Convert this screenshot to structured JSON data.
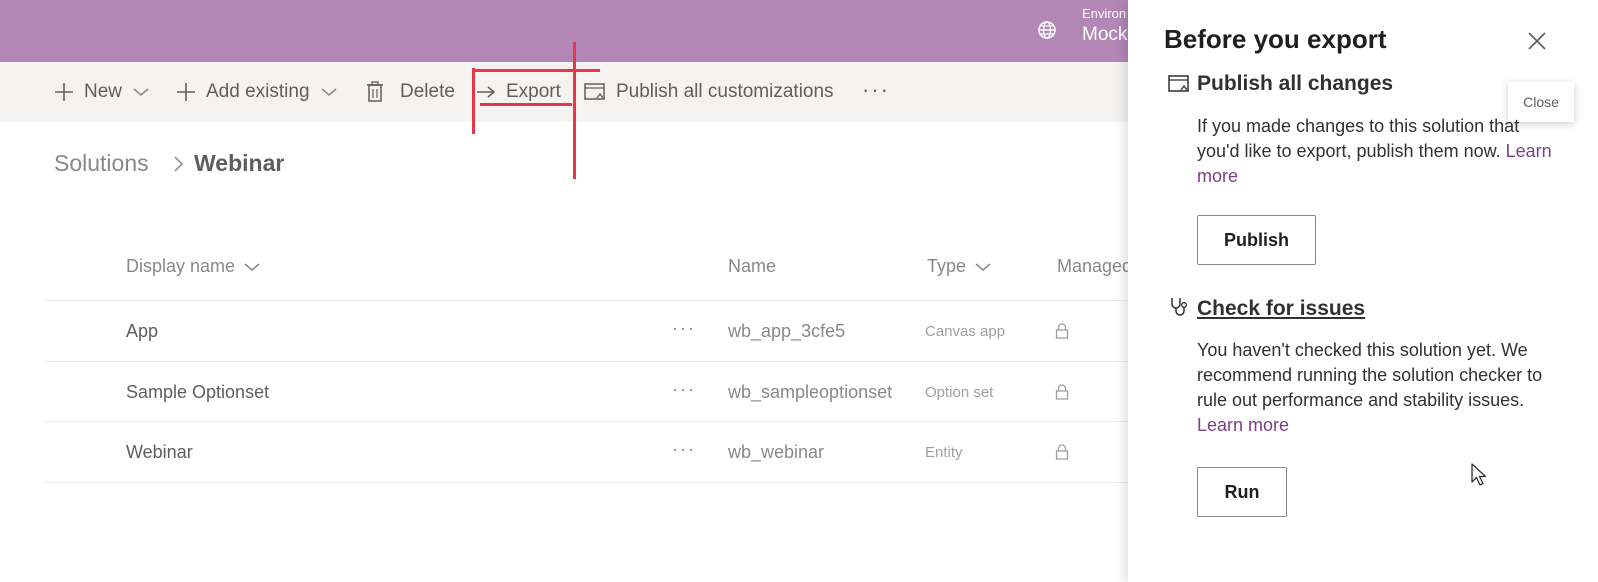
{
  "header": {
    "environment_label": "Environ",
    "environment_name": "Mocku",
    "globe_icon": "globe-icon"
  },
  "commandbar": {
    "new_label": "New",
    "add_existing_label": "Add existing",
    "delete_label": "Delete",
    "export_label": "Export",
    "publish_label": "Publish all customizations",
    "more_label": "···"
  },
  "breadcrumb": {
    "root": "Solutions",
    "current": "Webinar"
  },
  "table": {
    "columns": {
      "display_name": "Display name",
      "name": "Name",
      "type": "Type",
      "managed": "Managed"
    },
    "rows": [
      {
        "display_name": "App",
        "more": "···",
        "name": "wb_app_3cfe5",
        "type": "Canvas app"
      },
      {
        "display_name": "Sample Optionset",
        "more": "···",
        "name": "wb_sampleoptionset",
        "type": "Option set"
      },
      {
        "display_name": "Webinar",
        "more": "···",
        "name": "wb_webinar",
        "type": "Entity"
      }
    ]
  },
  "panel": {
    "title": "Before you export",
    "close_tooltip": "Close",
    "publish_section": {
      "title": "Publish all changes",
      "text": "If you made changes to this solution that you'd like to export, publish them now.",
      "link": "Learn more",
      "button": "Publish"
    },
    "check_section": {
      "title": "Check for issues",
      "text": "You haven't checked this solution yet. We recommend running the solution checker to rule out performance and stability issues.",
      "link": "Learn more",
      "button": "Run"
    }
  },
  "colors": {
    "header_bg": "#b287b6",
    "commandbar_bg": "#f4f3f2",
    "link": "#7b3f85",
    "annotation": "#e5394a"
  }
}
